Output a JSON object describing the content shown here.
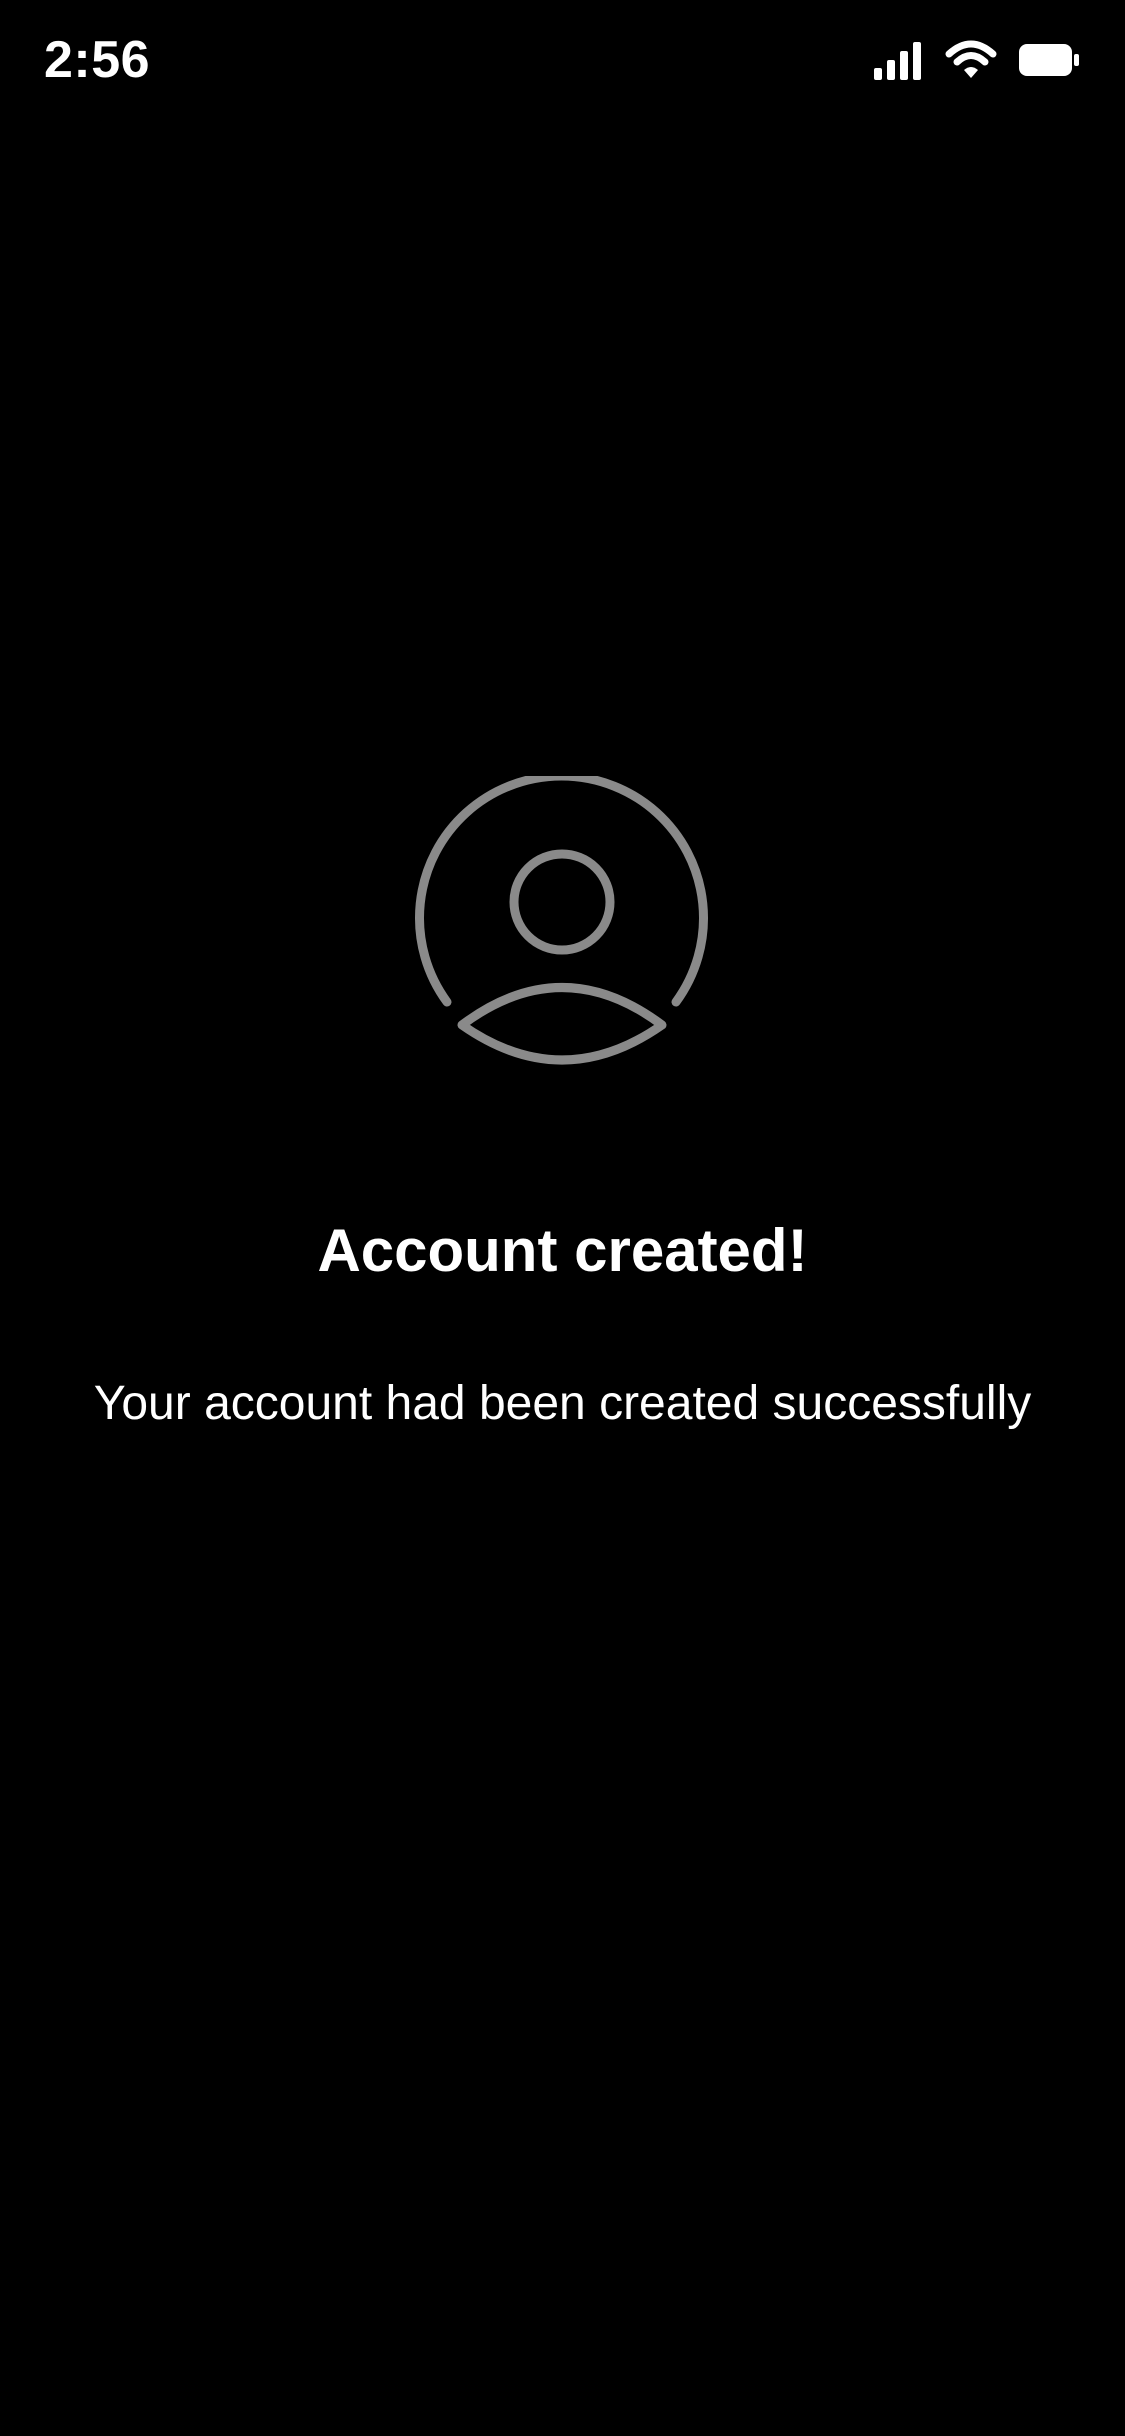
{
  "status_bar": {
    "time": "2:56",
    "icons": [
      "cellular-signal-icon",
      "wifi-icon",
      "battery-icon"
    ]
  },
  "main": {
    "avatar_icon": "user-circle-icon",
    "title": "Account created!",
    "message": "Your account had been created successfully"
  },
  "colors": {
    "background": "#000000",
    "text": "#ffffff",
    "icon": "#8a8a8a"
  }
}
